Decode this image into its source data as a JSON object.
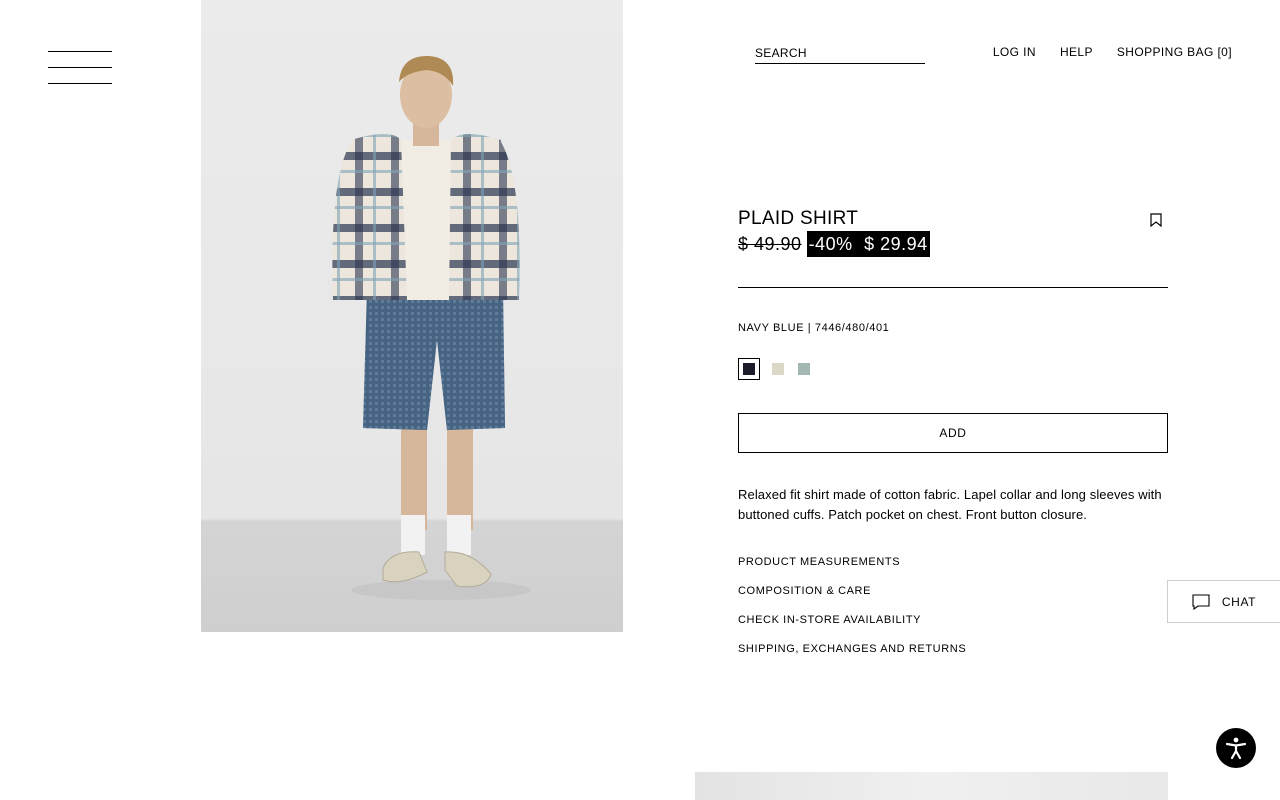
{
  "header": {
    "search_placeholder": "SEARCH",
    "login_label": "LOG IN",
    "help_label": "HELP",
    "bag_label": "SHOPPING BAG [0]"
  },
  "product": {
    "name": "PLAID SHIRT",
    "old_price": "$ 49.90",
    "discount": "-40%",
    "new_price": "$ 29.94",
    "color_line": "NAVY BLUE | 7446/480/401",
    "colors": [
      "#1b1b2a",
      "#dcd8c8",
      "#a3b7b3"
    ],
    "selected_color_index": 0,
    "add_label": "ADD",
    "description": "Relaxed fit shirt made of cotton fabric. Lapel collar and long sleeves with buttoned cuffs. Patch pocket on chest. Front button closure.",
    "info_links": [
      "PRODUCT MEASUREMENTS",
      "COMPOSITION & CARE",
      "CHECK IN-STORE AVAILABILITY",
      "SHIPPING, EXCHANGES AND RETURNS"
    ]
  },
  "chat_label": "CHAT",
  "icons": {
    "menu": "hamburger-menu-icon",
    "bookmark": "bookmark-icon",
    "chat": "chat-bubble-icon",
    "accessibility": "accessibility-icon"
  }
}
